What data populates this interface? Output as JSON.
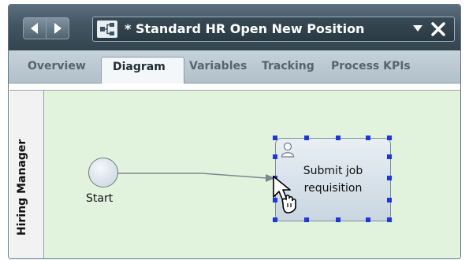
{
  "titlebar": {
    "back_icon": "chevron-left-icon",
    "forward_icon": "chevron-right-icon",
    "process_icon": "process-app-icon",
    "title": "* Standard HR Open New Position",
    "dropdown_icon": "dropdown-triangle-icon",
    "close_icon": "close-icon"
  },
  "tabs": [
    {
      "label": "Overview",
      "selected": false
    },
    {
      "label": "Diagram",
      "selected": true
    },
    {
      "label": "Variables",
      "selected": false
    },
    {
      "label": "Tracking",
      "selected": false
    },
    {
      "label": "Process KPIs",
      "selected": false
    }
  ],
  "diagram": {
    "lane_label": "Hiring Manager",
    "start_event_label": "Start",
    "task_label_line1": "Submit job",
    "task_label_line2": "requisition",
    "task_icon": "user-icon",
    "cursor_icon": "grab-hand-cursor-icon"
  },
  "colors": {
    "titlebar": "#425561",
    "tabstrip": "#bcc9d1",
    "lane_background": "#e2f3dd",
    "selection_handle": "#1a36e6"
  }
}
